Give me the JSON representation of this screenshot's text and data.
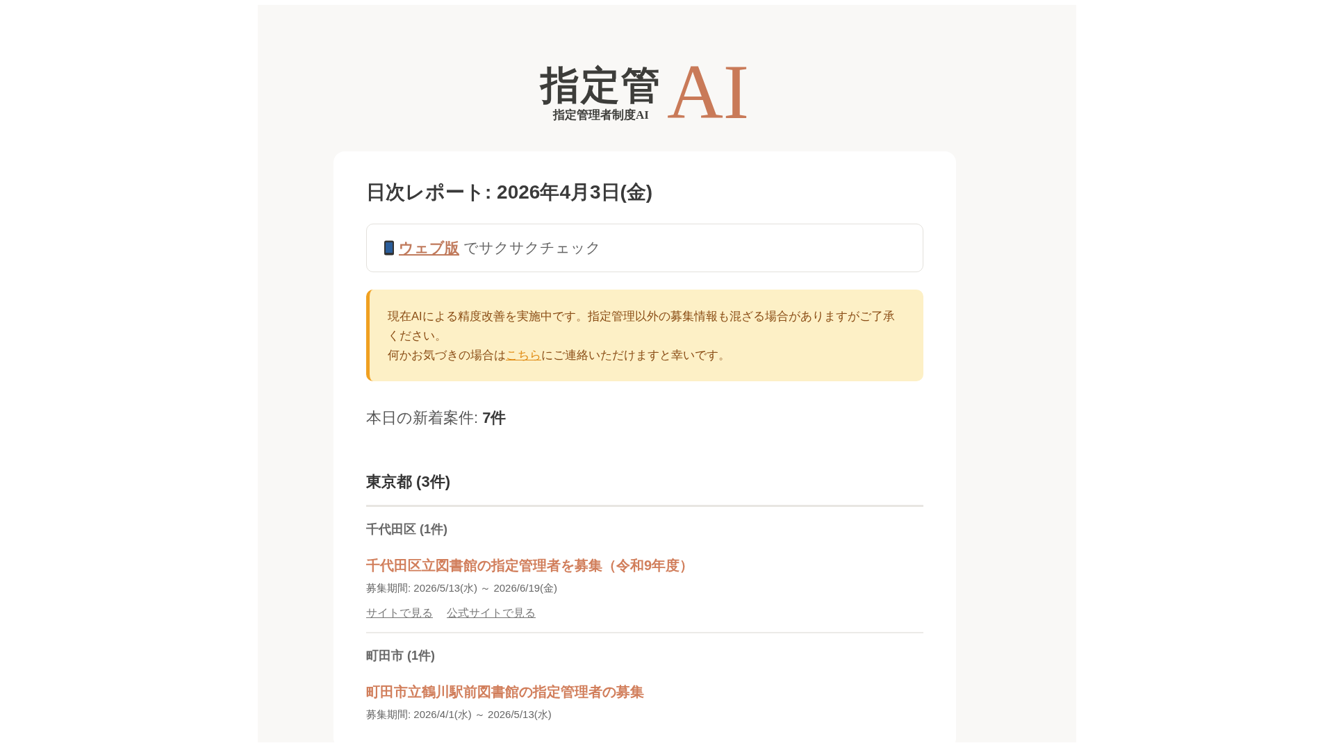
{
  "logo": {
    "main": "指定管",
    "subtitle": "指定管理者制度AI",
    "accent": "AI"
  },
  "report_title": "日次レポート: 2026年4月3日(金)",
  "web_banner": {
    "link": "ウェブ版",
    "text": "でサクサクチェック"
  },
  "notice": {
    "lines": [
      "現在AIによる精度改善を実施中です。指定管理以外の募集情報も混ざる場合がありますがご了承ください。"
    ],
    "before_link": "何かお気づきの場合は",
    "link": "こちら",
    "after_link": "にご連絡いただけますと幸いです。"
  },
  "summary": "本日の新着案件: **7件**",
  "sections": [
    {
      "heading": "東京都 (3件)",
      "groups": [
        {
          "name": "千代田区 (1件)",
          "items": [
            {
              "title": "千代田区立図書館の指定管理者を募集（令和9年度）",
              "period": "募集期間: 2026/5/13(水) ～ 2026/6/19(金)",
              "links": [
                "サイトで見る",
                "公式サイトで見る"
              ]
            }
          ]
        },
        {
          "name": "町田市 (1件)",
          "items": [
            {
              "title": "町田市立鶴川駅前図書館の指定管理者の募集",
              "period": "募集期間: 2026/4/1(水) ～ 2026/5/13(水)"
            }
          ]
        }
      ]
    }
  ]
}
